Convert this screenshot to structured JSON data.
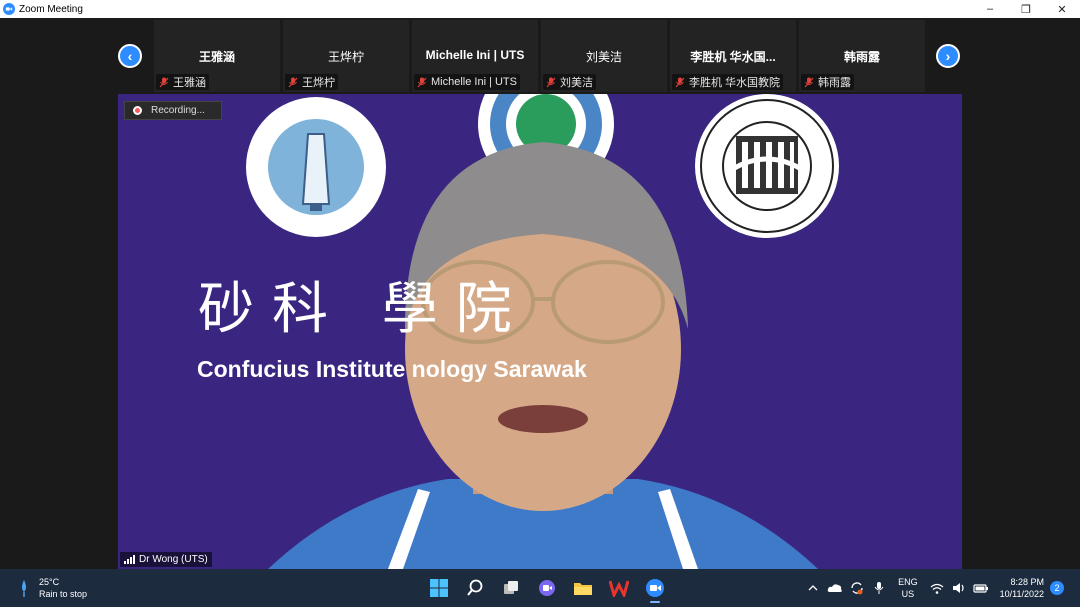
{
  "window": {
    "title": "Zoom Meeting",
    "controls": [
      "–",
      "❐",
      "✕"
    ]
  },
  "participants": [
    {
      "name": "王雅涵",
      "label": "王雅涵"
    },
    {
      "name": "王烨柠",
      "label": "王烨柠"
    },
    {
      "name": "Michelle Ini | UTS",
      "label": "Michelle Ini | UTS"
    },
    {
      "name": "刘美洁",
      "label": "刘美洁"
    },
    {
      "name": "李胜机 华水国...",
      "label": "李胜机 华水国教院"
    },
    {
      "name": "韩雨露",
      "label": "韩雨露"
    }
  ],
  "nav": {
    "prev": "‹",
    "next": "›"
  },
  "main_video": {
    "recording": "Recording...",
    "speaker": "Dr Wong (UTS)",
    "banner_cn": "砂科 學院",
    "banner_en": "Confucius Institute nology Sarawak",
    "background_color": "#3a2680"
  },
  "taskbar": {
    "temperature": "25°C",
    "weather": "Rain to stop",
    "lang_top": "ENG",
    "lang_bottom": "US",
    "time": "8:28 PM",
    "date": "10/11/2022",
    "notifications": "2"
  },
  "colors": {
    "accent": "#2d8cff",
    "taskbar": "#1c2b3e",
    "mute": "#e0413a"
  }
}
